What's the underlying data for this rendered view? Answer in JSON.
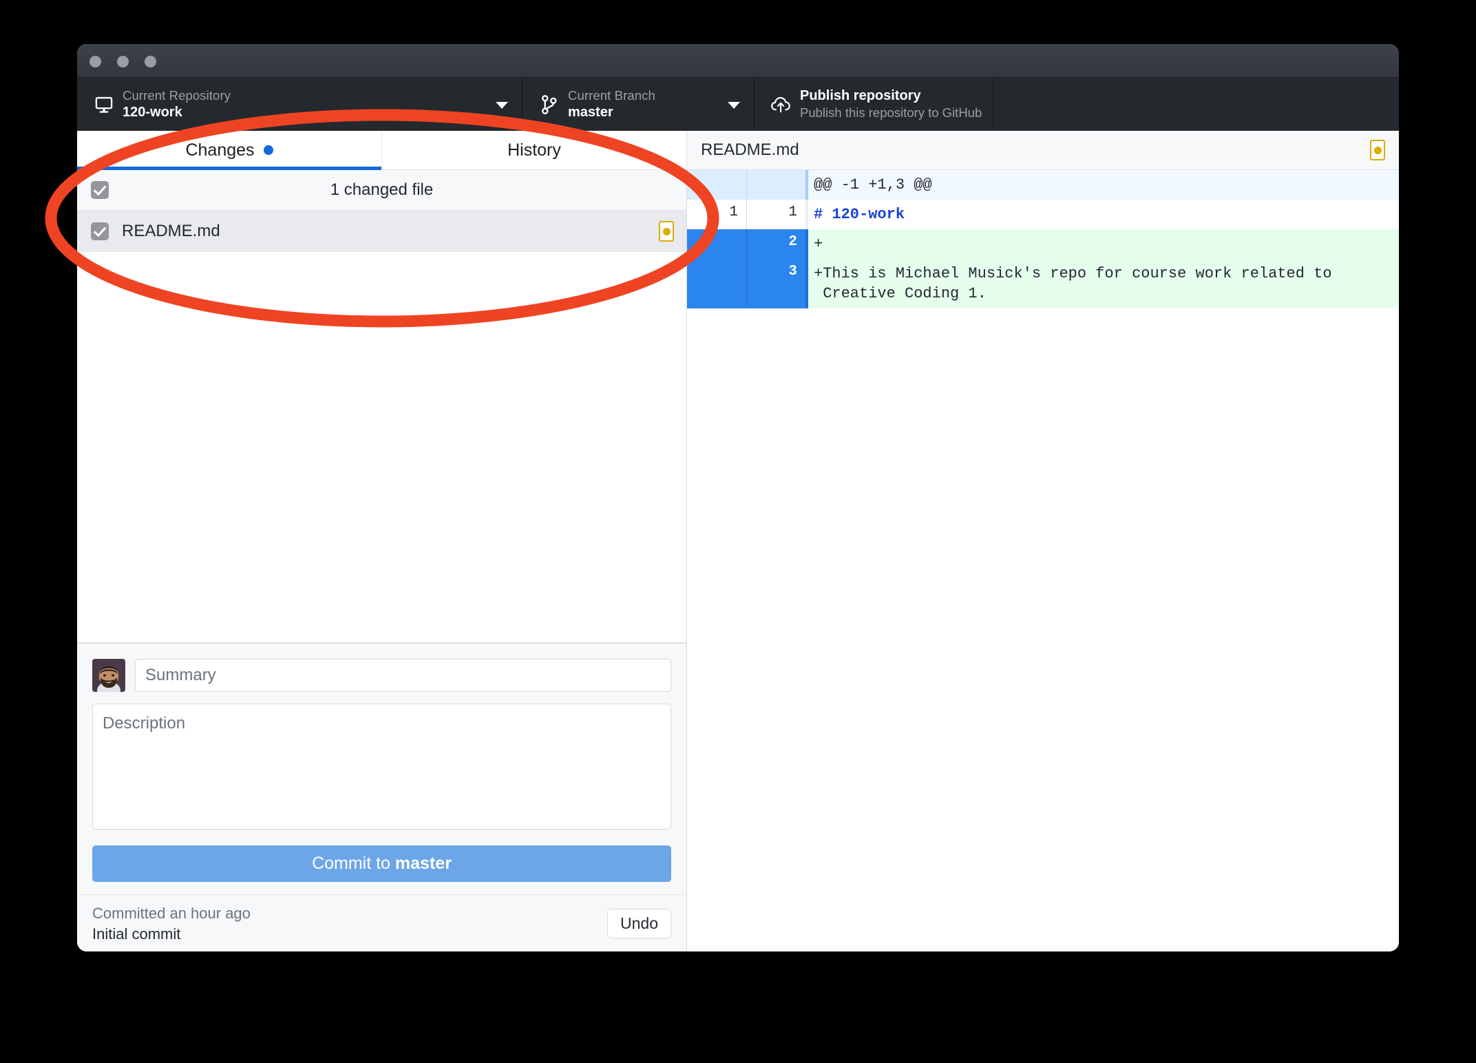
{
  "window": {
    "traffic_lights": [
      "close-button",
      "minimize-button",
      "zoom-button"
    ]
  },
  "toolbar": {
    "repository": {
      "label": "Current Repository",
      "value": "120-work",
      "icon": "desktop-icon",
      "caret": "chevron-down-icon"
    },
    "branch": {
      "label": "Current Branch",
      "value": "master",
      "icon": "branch-icon",
      "caret": "chevron-down-icon"
    },
    "publish": {
      "title": "Publish repository",
      "subtitle": "Publish this repository to GitHub",
      "icon": "cloud-upload-icon"
    }
  },
  "sidebar": {
    "tabs": [
      {
        "label": "Changes",
        "active": true,
        "has_dot": true
      },
      {
        "label": "History",
        "active": false,
        "has_dot": false
      }
    ],
    "changed_header": {
      "text": "1 changed file",
      "checked": true
    },
    "files": [
      {
        "name": "README.md",
        "checked": true,
        "status": "modified",
        "status_color": "#dbab09"
      }
    ],
    "commit": {
      "summary_placeholder": "Summary",
      "summary_value": "",
      "description_placeholder": "Description",
      "description_value": "",
      "button_prefix": "Commit to ",
      "button_branch": "master"
    },
    "undo": {
      "when": "Committed an hour ago",
      "message": "Initial commit",
      "button": "Undo"
    }
  },
  "diff": {
    "filename": "README.md",
    "status_badge": {
      "icon": "modified-dot-icon",
      "color": "#dbab09"
    },
    "lines": [
      {
        "type": "hunk",
        "old": "",
        "new": "",
        "code": "@@ -1 +1,3 @@"
      },
      {
        "type": "context",
        "old": "1",
        "new": "1",
        "code": "# 120-work",
        "markdown_heading": true
      },
      {
        "type": "add",
        "old": "",
        "new": "2",
        "code": "+"
      },
      {
        "type": "add",
        "old": "",
        "new": "3",
        "code": "+This is Michael Musick's repo for course work related to\n Creative Coding 1."
      }
    ]
  },
  "annotation": {
    "shape": "ellipse",
    "color": "#ef4423",
    "target": "changes-tab-and-file-list"
  },
  "colors": {
    "toolbar_bg": "#24292e",
    "accent_blue": "#1469dc",
    "add_green": "#e6ffed",
    "gutter_blue": "#2b85ee",
    "annotation_red": "#ef4423"
  }
}
